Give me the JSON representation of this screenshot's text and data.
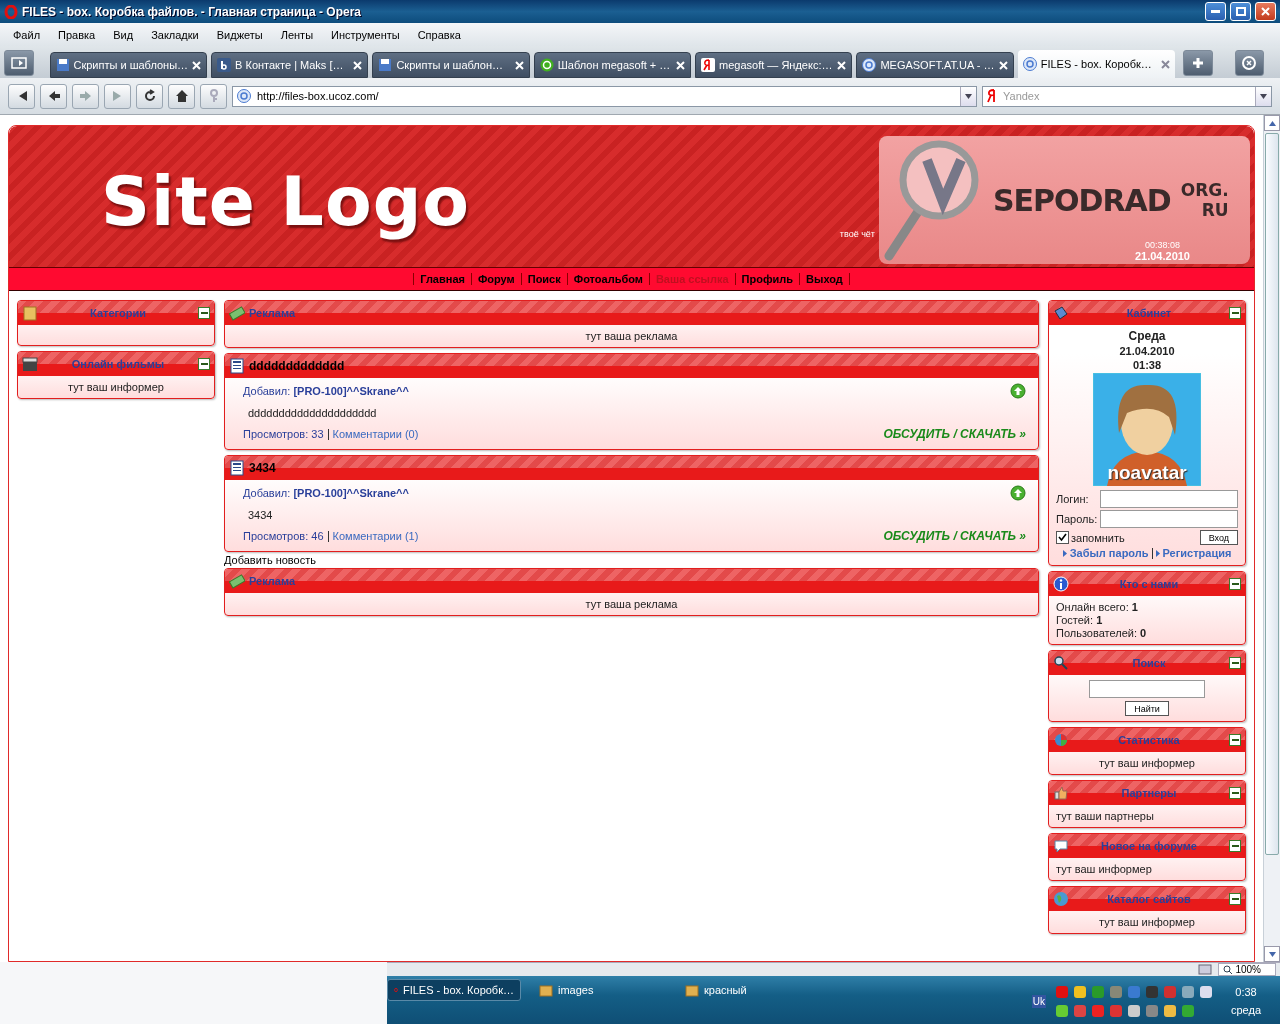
{
  "window": {
    "title": "FILES - box. Коробка файлов. - Главная страница - Opera"
  },
  "menu": [
    "Файл",
    "Правка",
    "Вид",
    "Закладки",
    "Виджеты",
    "Ленты",
    "Инструменты",
    "Справка"
  ],
  "tabs": [
    {
      "label": "Скрипты и шаблоны…",
      "kind": "disk",
      "selected": false
    },
    {
      "label": "В Контакте | Maks […",
      "kind": "vk",
      "selected": false
    },
    {
      "label": "Скрипты и шаблон…",
      "kind": "disk",
      "selected": false
    },
    {
      "label": "Шаблон megasoft + …",
      "kind": "green",
      "selected": false
    },
    {
      "label": "megasoft — Яндекс:…",
      "kind": "yandex",
      "selected": false
    },
    {
      "label": "MEGASOFT.AT.UA - …",
      "kind": "ucoz",
      "selected": false
    },
    {
      "label": "FILES - box. Коробк…",
      "kind": "ucoz",
      "selected": true
    }
  ],
  "address": {
    "value": "http://files-box.ucoz.com/"
  },
  "search": {
    "placeholder": "Yandex"
  },
  "header": {
    "logo": "Site Logo",
    "slogan": "твоё чёт",
    "brand": "SEPODRAD",
    "brand_suffix": [
      "ORG.",
      "RU"
    ],
    "time": "00:38:08",
    "date": "21.04.2010"
  },
  "nav": [
    {
      "label": "Главная",
      "disabled": false
    },
    {
      "label": "Форум",
      "disabled": false
    },
    {
      "label": "Поиск",
      "disabled": false
    },
    {
      "label": "Фотоальбом",
      "disabled": false
    },
    {
      "label": "Ваша ссылка",
      "disabled": true
    },
    {
      "label": "Профиль",
      "disabled": false
    },
    {
      "label": "Выход",
      "disabled": false
    }
  ],
  "left": [
    {
      "kind": "centered",
      "title": "Категории",
      "collapsible": true
    },
    {
      "kind": "centered",
      "title": "Онлайн фильмы",
      "collapsible": true,
      "text": "тут ваш информер"
    }
  ],
  "center": [
    {
      "kind": "centered",
      "title": "Реклама",
      "collapsible": false,
      "text": "тут ваша реклама"
    },
    {
      "kind": "news",
      "title": "ddddddddddddd",
      "collapsible": false,
      "author_label": "Добавил:",
      "author": "[PRO-100]^^Skrane^^",
      "body": "ddddddddddddddddddddd",
      "views": "Просмотров: 33",
      "comments": "Комментарии (0)",
      "more": "ОБСУДИТЬ / СКАЧАТЬ »"
    },
    {
      "kind": "news",
      "title": "3434",
      "collapsible": false,
      "author_label": "Добавил:",
      "author": "[PRO-100]^^Skrane^^",
      "body": "3434",
      "views": "Просмотров: 46",
      "comments": "Комментарии (1)",
      "more": "ОБСУДИТЬ / СКАЧАТЬ »"
    },
    {
      "kind": "link",
      "text": "Добавить новость"
    },
    {
      "kind": "centered",
      "title": "Реклама",
      "collapsible": false,
      "text": "тут ваша реклама"
    }
  ],
  "right": [
    {
      "kind": "login",
      "title": "Кабинет",
      "collapsible": true,
      "day": "Среда",
      "date": "21.04.2010",
      "time": "01:38",
      "avatar_label": "noavatar",
      "login_label": "Логин:",
      "password_label": "Пароль:",
      "remember": {
        "label": "запомнить",
        "checked": true
      },
      "submit": "Вход",
      "links": [
        "Забыл пароль",
        "Регистрация"
      ]
    },
    {
      "kind": "stats",
      "title": "Кто с нами",
      "collapsible": true,
      "lines": [
        {
          "label": "Онлайн всего:",
          "value": "1"
        },
        {
          "label": "Гостей:",
          "value": "1"
        },
        {
          "label": "Пользователей:",
          "value": "0"
        }
      ]
    },
    {
      "kind": "search",
      "title": "Поиск",
      "collapsible": true,
      "button": "Найти"
    },
    {
      "kind": "centered",
      "title": "Статистика",
      "collapsible": true,
      "text": "тут ваш информер"
    },
    {
      "kind": "plain",
      "title": "Партнеры",
      "collapsible": true,
      "text": "тут ваши партнеры"
    },
    {
      "kind": "plain",
      "title": "Новое на форуме",
      "collapsible": true,
      "text": "тут ваш информер"
    },
    {
      "kind": "centered",
      "title": "Каталог сайтов",
      "collapsible": true,
      "text": "тут ваш информер"
    }
  ],
  "status_bar": {
    "zoom": "100%"
  },
  "taskbar": {
    "tasks": [
      {
        "label": "FILES - box. Коробк…",
        "kind": "opera",
        "selected": true
      },
      {
        "label": "images",
        "kind": "folder",
        "selected": false
      },
      {
        "label": "красный",
        "kind": "folder",
        "selected": false
      }
    ],
    "language": "Uk",
    "clock": "0:38",
    "day": "среда"
  }
}
